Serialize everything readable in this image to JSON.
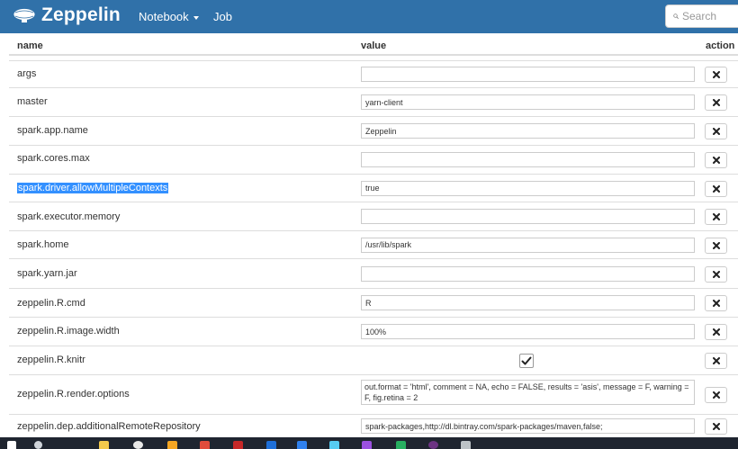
{
  "navbar": {
    "brand": "Zeppelin",
    "menu": [
      {
        "label": "Notebook",
        "dropdown": true
      },
      {
        "label": "Job",
        "dropdown": false
      }
    ],
    "search_placeholder": "Search"
  },
  "table": {
    "columns": [
      "name",
      "value",
      "action"
    ],
    "rows": [
      {
        "name": "args",
        "value": "",
        "type": "text"
      },
      {
        "name": "master",
        "value": "yarn-client",
        "type": "text"
      },
      {
        "name": "spark.app.name",
        "value": "Zeppelin",
        "type": "text"
      },
      {
        "name": "spark.cores.max",
        "value": "",
        "type": "text"
      },
      {
        "name": "spark.driver.allowMultipleContexts",
        "value": "true",
        "type": "text",
        "selected": true
      },
      {
        "name": "spark.executor.memory",
        "value": "",
        "type": "text"
      },
      {
        "name": "spark.home",
        "value": "/usr/lib/spark",
        "type": "text"
      },
      {
        "name": "spark.yarn.jar",
        "value": "",
        "type": "text"
      },
      {
        "name": "zeppelin.R.cmd",
        "value": "R",
        "type": "text"
      },
      {
        "name": "zeppelin.R.image.width",
        "value": "100%",
        "type": "text"
      },
      {
        "name": "zeppelin.R.knitr",
        "value": true,
        "type": "checkbox"
      },
      {
        "name": "zeppelin.R.render.options",
        "value": "out.format = 'html', comment = NA, echo = FALSE, results = 'asis', message = F, warning = F, fig.retina = 2",
        "type": "textarea"
      },
      {
        "name": "zeppelin.dep.additionalRemoteRepository",
        "value": "spark-packages,http://dl.bintray.com/spark-packages/maven,false;",
        "type": "text"
      }
    ]
  },
  "icons": {
    "logo": "zeppelin-logo-icon",
    "search": "search-icon",
    "delete": "close-icon",
    "check": "check-icon"
  },
  "colors": {
    "navbar": "#3071a9",
    "selection": "#3390ff",
    "border": "#dddddd"
  }
}
